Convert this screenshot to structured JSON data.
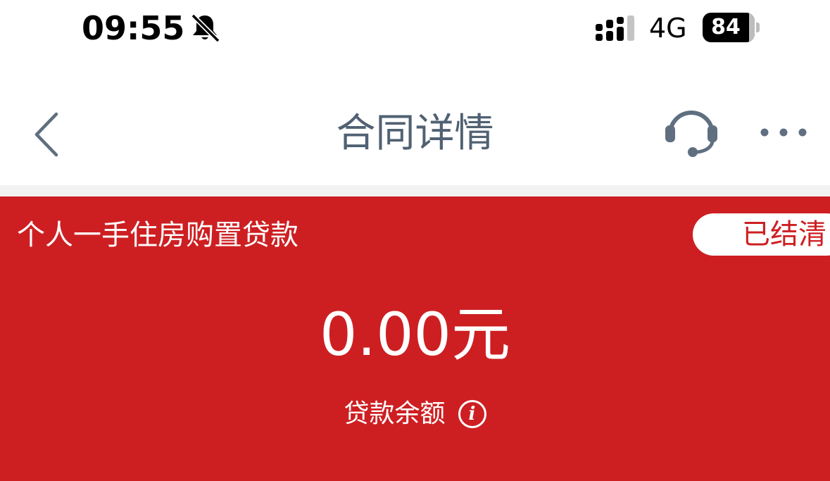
{
  "status_bar": {
    "time": "09:55",
    "network": "4G",
    "battery": "84",
    "icons": [
      "bell-slash-icon",
      "signal-icon"
    ]
  },
  "nav": {
    "title": "合同详情",
    "icons": [
      "chevron-left-icon",
      "headset-icon",
      "more-dots-icon"
    ]
  },
  "loan": {
    "type": "个人一手住房购置贷款",
    "status": "已结清",
    "balance": "0.00元",
    "balance_label": "贷款余额",
    "info_icon": "i"
  },
  "colors": {
    "accent_red": "#cd1f22",
    "title_gray": "#506173",
    "nav_icon_gray": "#5f6f80"
  }
}
